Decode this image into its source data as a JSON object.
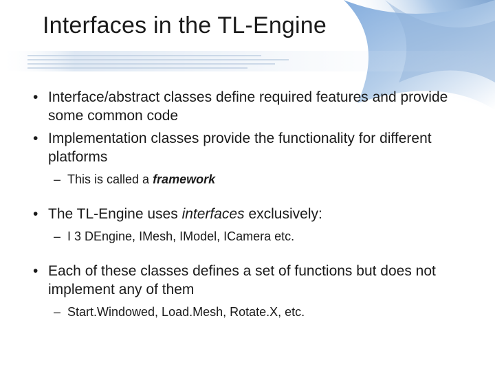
{
  "slide": {
    "title": "Interfaces in the TL-Engine",
    "bullets": [
      {
        "segs": [
          {
            "t": "Interface/abstract classes define required features and provide some common code"
          }
        ]
      },
      {
        "segs": [
          {
            "t": "Implementation classes provide the functionality for different platforms"
          }
        ],
        "sub": [
          {
            "segs": [
              {
                "t": "This is called a "
              },
              {
                "t": "framework",
                "bi": true
              }
            ]
          }
        ]
      },
      {
        "gap": true,
        "segs": [
          {
            "t": "The TL-Engine uses "
          },
          {
            "t": "interfaces",
            "i": true
          },
          {
            "t": " exclusively:"
          }
        ],
        "sub": [
          {
            "segs": [
              {
                "t": "I 3 DEngine, IMesh, IModel, ICamera etc."
              }
            ]
          }
        ]
      },
      {
        "gap": true,
        "segs": [
          {
            "t": "Each of these classes defines a set of functions but does not implement any of them"
          }
        ],
        "sub": [
          {
            "segs": [
              {
                "t": "Start.Windowed, Load.Mesh, Rotate.X, etc."
              }
            ]
          }
        ]
      }
    ]
  }
}
